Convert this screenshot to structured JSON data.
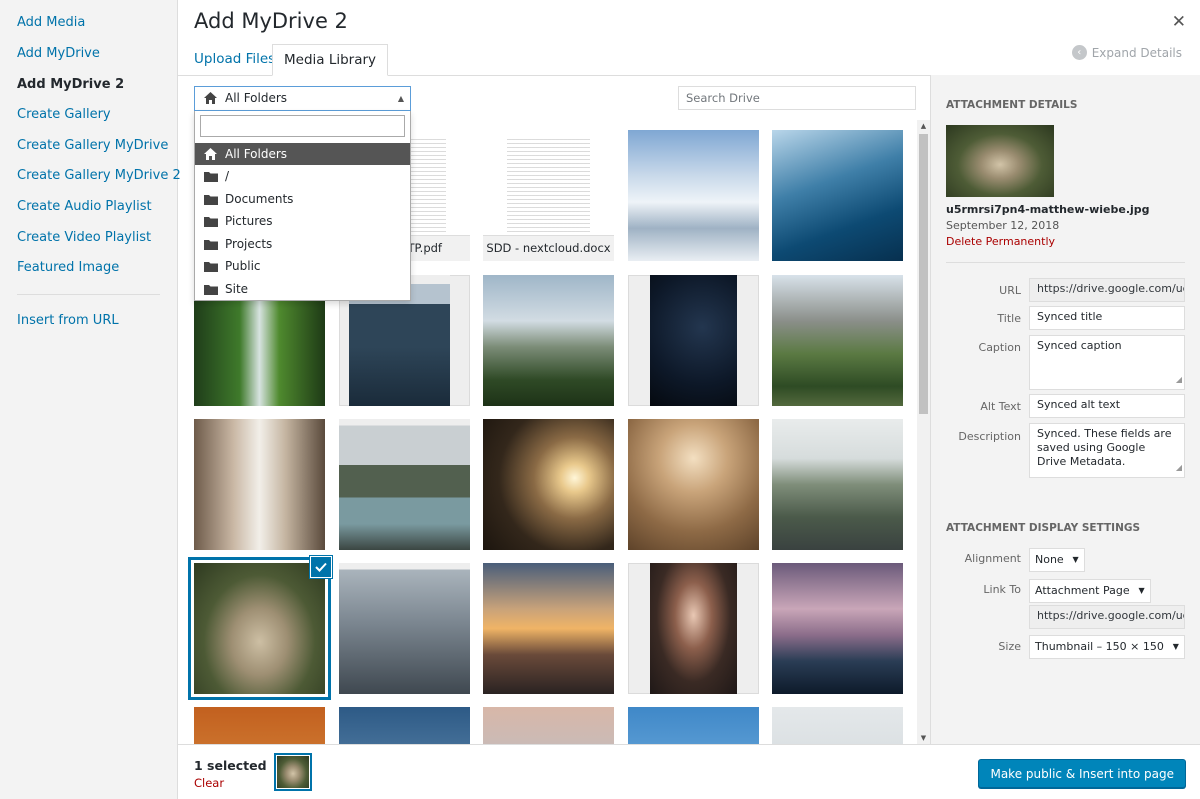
{
  "menu": {
    "items": [
      "Add Media",
      "Add MyDrive",
      "Add MyDrive 2",
      "Create Gallery",
      "Create Gallery MyDrive",
      "Create Gallery MyDrive 2",
      "Create Audio Playlist",
      "Create Video Playlist",
      "Featured Image"
    ],
    "active": "Add MyDrive 2",
    "insert_url": "Insert from URL"
  },
  "header": {
    "title": "Add MyDrive 2",
    "close_glyph": "✕",
    "expand_label": "Expand Details"
  },
  "tabs": {
    "upload": "Upload Files",
    "library": "Media Library"
  },
  "folder_select": {
    "selected": "All Folders",
    "search_value": "",
    "options": [
      "All Folders",
      "/",
      "Documents",
      "Pictures",
      "Projects",
      "Public",
      "Site"
    ]
  },
  "search": {
    "placeholder": "Search Drive"
  },
  "grid": {
    "doc_names": [
      "...TP.pdf",
      "SDD - nextcloud.docx"
    ]
  },
  "sidebar": {
    "details_heading": "ATTACHMENT DETAILS",
    "filename": "u5rmrsi7pn4-matthew-wiebe.jpg",
    "date": "September 12, 2018",
    "delete_label": "Delete Permanently",
    "url_label": "URL",
    "url_value": "https://drive.google.com/uc?",
    "title_label": "Title",
    "title_value": "Synced title",
    "caption_label": "Caption",
    "caption_value": "Synced caption",
    "alt_label": "Alt Text",
    "alt_value": "Synced alt text",
    "description_label": "Description",
    "description_value": "Synced. These fields are saved using Google Drive Metadata.",
    "display_heading": "ATTACHMENT DISPLAY SETTINGS",
    "alignment_label": "Alignment",
    "alignment_value": "None",
    "link_label": "Link To",
    "link_value": "Attachment Page",
    "link_url": "https://drive.google.com/uc?",
    "size_label": "Size",
    "size_value": "Thumbnail – 150 × 150"
  },
  "footer": {
    "selected_count": "1 selected",
    "clear_label": "Clear",
    "insert_button": "Make public & Insert into page"
  },
  "colors": {
    "link": "#0073aa",
    "danger": "#aa0000",
    "primary_button": "#0085ba",
    "dropdown_highlight": "#555555"
  }
}
